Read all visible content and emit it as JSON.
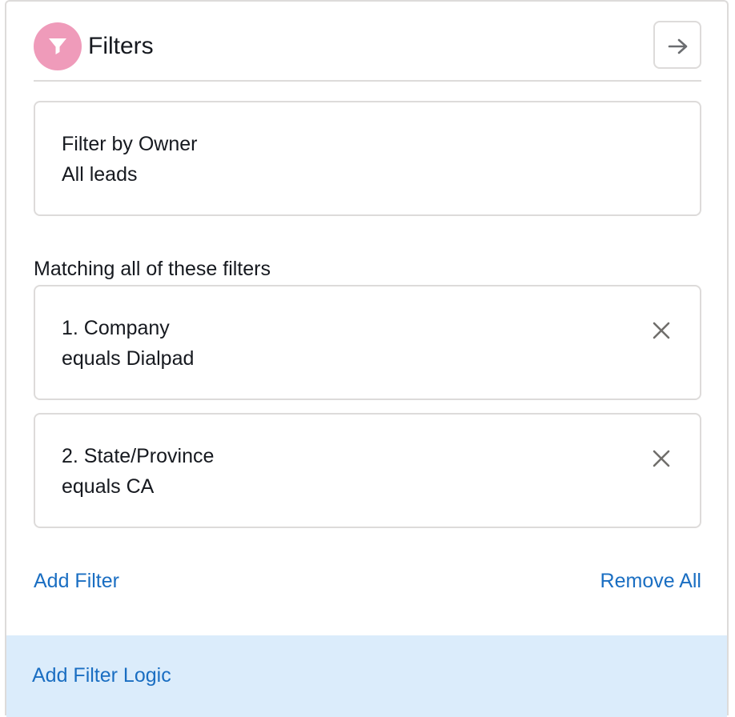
{
  "header": {
    "title": "Filters",
    "badge_color": "#ef9bba"
  },
  "owner_filter": {
    "label": "Filter by Owner",
    "value": "All leads"
  },
  "filters_section": {
    "label": "Matching all of these filters",
    "items": [
      {
        "field": "1. Company",
        "condition": "equals Dialpad"
      },
      {
        "field": "2. State/Province",
        "condition": "equals CA"
      }
    ]
  },
  "actions": {
    "add_filter": "Add Filter",
    "remove_all": "Remove All",
    "add_filter_logic": "Add Filter Logic"
  },
  "colors": {
    "link": "#1a6ec2",
    "logic_bar_bg": "#dbecfb",
    "border": "#dddbda"
  }
}
